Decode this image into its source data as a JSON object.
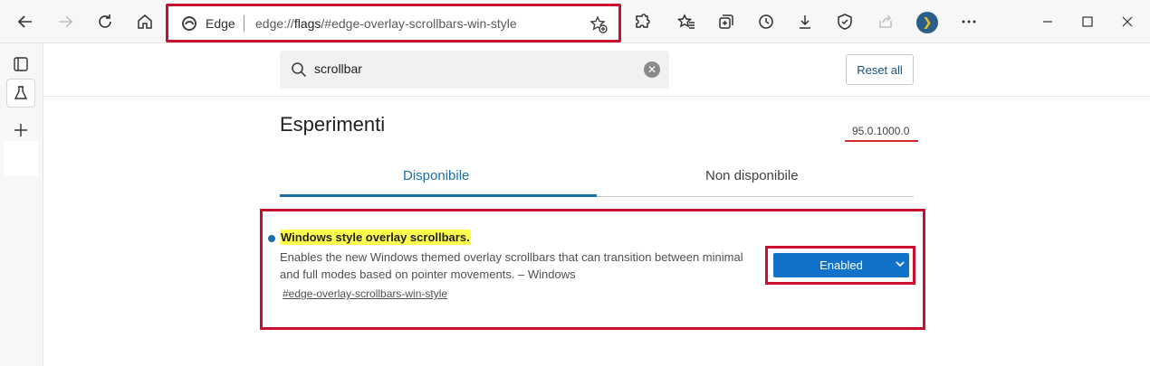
{
  "address_bar": {
    "site_label": "Edge",
    "url_prefix": "edge://",
    "url_host": "flags",
    "url_rest": "/#edge-overlay-scrollbars-win-style"
  },
  "search": {
    "value": "scrollbar",
    "clear_glyph": "✕"
  },
  "reset_all_label": "Reset all",
  "page_title": "Esperimenti",
  "version": "95.0.1000.0",
  "tabs": [
    {
      "label": "Disponibile",
      "selected": true
    },
    {
      "label": "Non disponibile",
      "selected": false
    }
  ],
  "experiment": {
    "title": "Windows style overlay scrollbars.",
    "description": "Enables the new Windows themed overlay scrollbars that can transition between minimal and full modes based on pointer movements. – Windows",
    "link": "#edge-overlay-scrollbars-win-style",
    "selected_option": "Enabled"
  },
  "colors": {
    "accent": "#1a6fa8",
    "highlight": "#ffff4d",
    "annotation_red": "#c8102e",
    "dropdown": "#1072c8"
  }
}
